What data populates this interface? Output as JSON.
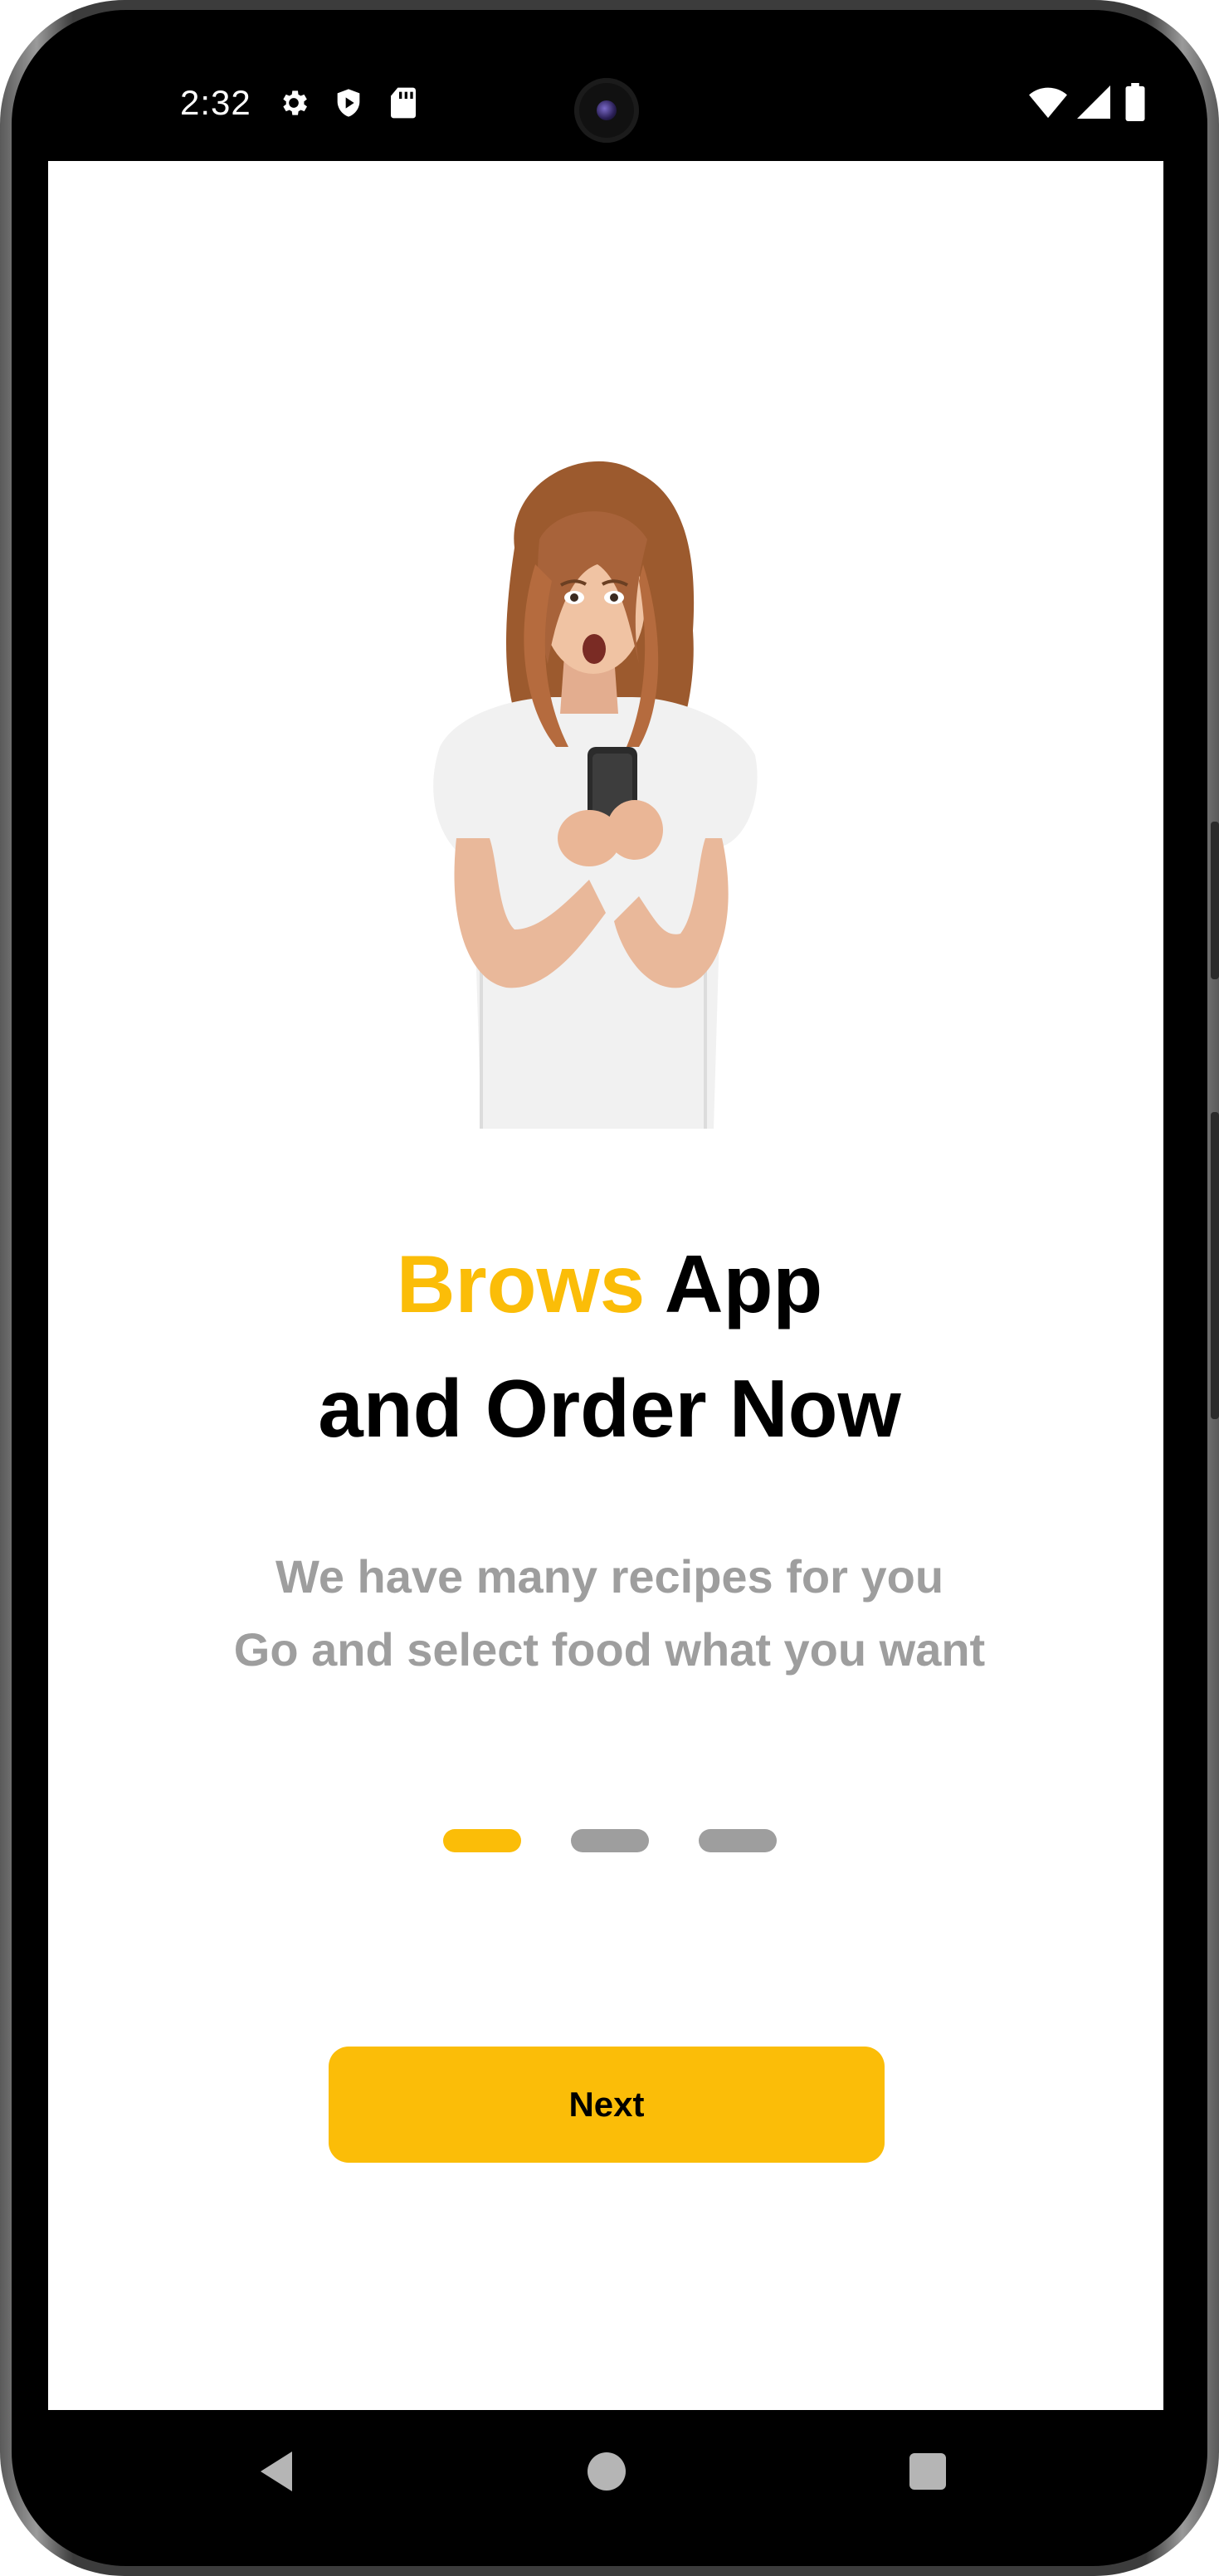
{
  "status_bar": {
    "time": "2:32",
    "left_icons": [
      "gear-icon",
      "shield-play-icon",
      "sd-card-icon"
    ],
    "right_icons": [
      "wifi-icon",
      "signal-icon",
      "battery-icon"
    ]
  },
  "onboarding": {
    "title_accent": "Brows",
    "title_rest_line1": " App",
    "title_line2": "and Order Now",
    "subtitle_line1": "We have many recipes for you",
    "subtitle_line2": "Go and select food what you want",
    "page_indicator": {
      "total": 3,
      "active_index": 0
    },
    "next_label": "Next"
  },
  "navigation_bar": {
    "buttons": [
      "back-icon",
      "home-icon",
      "recents-icon"
    ]
  },
  "colors": {
    "accent": "#fbbd08",
    "muted_text": "#9e9e9e",
    "inactive_dot": "#9e9e9e",
    "title_text": "#000000"
  }
}
